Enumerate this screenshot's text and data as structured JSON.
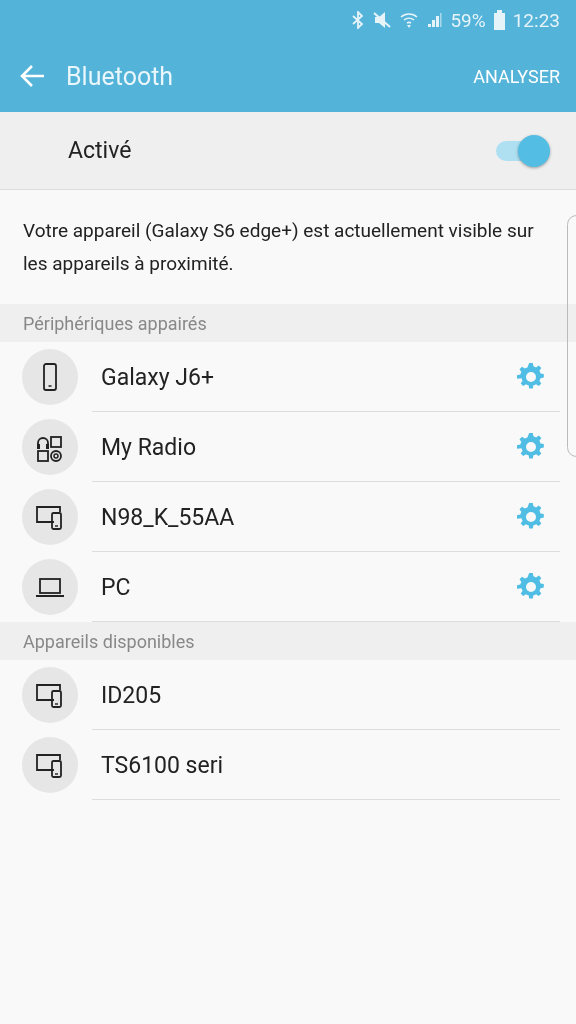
{
  "status_bar": {
    "battery": "59%",
    "time": "12:23"
  },
  "app_bar": {
    "title": "Bluetooth",
    "action": "ANALYSER"
  },
  "master_switch": {
    "label": "Activé",
    "on": true
  },
  "description": "Votre appareil (Galaxy S6 edge+) est actuellement visible sur les appareils à proximité.",
  "sections": [
    {
      "title": "Périphériques appairés",
      "devices": [
        {
          "name": "Galaxy J6+",
          "kind": "phone",
          "settings": true
        },
        {
          "name": "My Radio",
          "kind": "media",
          "settings": true
        },
        {
          "name": "N98_K_55AA",
          "kind": "multi",
          "settings": true
        },
        {
          "name": "PC",
          "kind": "laptop",
          "settings": true
        }
      ]
    },
    {
      "title": "Appareils disponibles",
      "devices": [
        {
          "name": "ID205",
          "kind": "multi",
          "settings": false
        },
        {
          "name": "TS6100 seri",
          "kind": "multi",
          "settings": false
        }
      ]
    }
  ]
}
